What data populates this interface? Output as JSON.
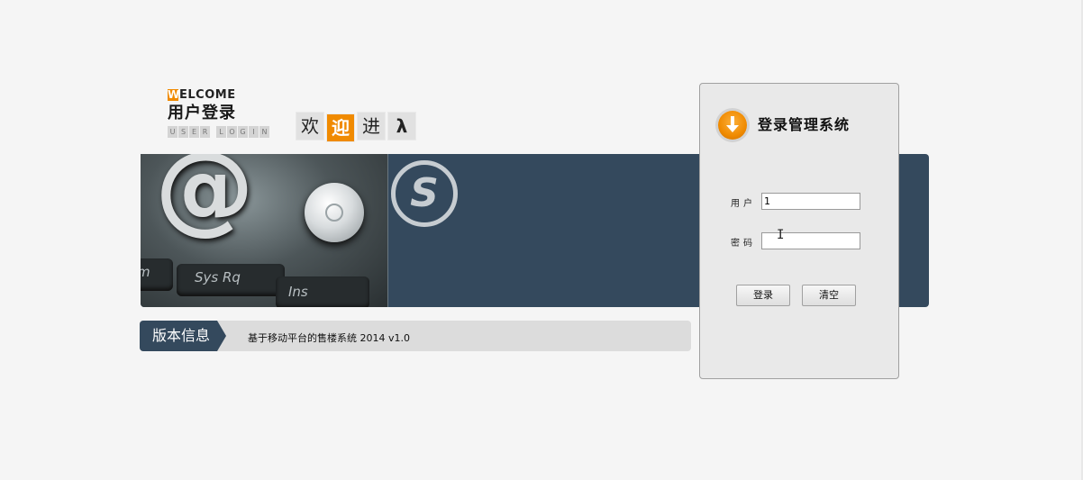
{
  "header": {
    "welcome_initial": "W",
    "welcome_rest": "ELCOME",
    "title_cn": "用户登录",
    "subtitle_letters": [
      "U",
      "S",
      "E",
      "R",
      "",
      "L",
      "O",
      "G",
      "I",
      "N"
    ],
    "welcome_tiles": [
      "欢",
      "迎",
      "进",
      "λ"
    ]
  },
  "banner": {
    "at_symbol": "@",
    "keys": [
      "m",
      "Sys Rq",
      "Ins"
    ],
    "logo_letter": "S"
  },
  "version": {
    "label": "版本信息",
    "text": "基于移动平台的售楼系统  2014 v1.0"
  },
  "login": {
    "title": "登录管理系统",
    "username_label": "用户",
    "password_label": "密码",
    "username_value": "1",
    "password_value": "",
    "login_button": "登录",
    "clear_button": "清空"
  },
  "colors": {
    "accent": "#f08a00",
    "banner": "#34495d",
    "panel": "#e9e9e9"
  }
}
